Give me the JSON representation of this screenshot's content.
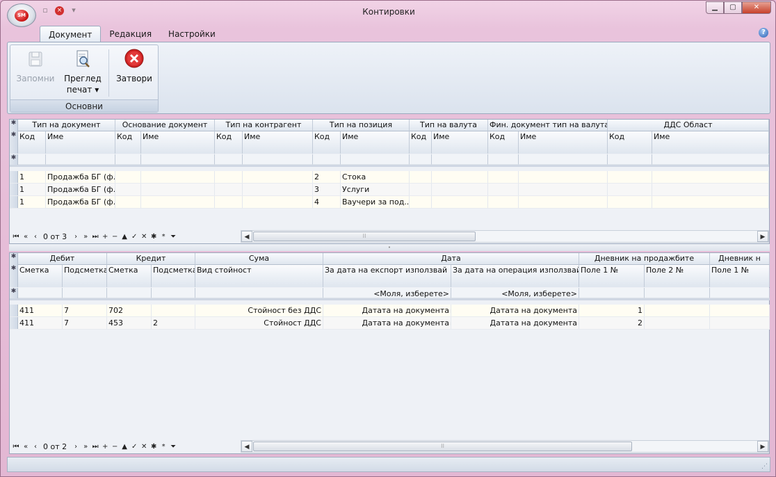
{
  "window": {
    "title": "Контировки"
  },
  "orb": {
    "logo_text": "SM"
  },
  "ribbon_tabs": [
    "Документ",
    "Редакция",
    "Настройки"
  ],
  "ribbon": {
    "group_label": "Основни",
    "save_label": "Запомни",
    "preview_label_1": "Преглед",
    "preview_label_2": "печат",
    "close_label": "Затвори"
  },
  "top_grid": {
    "groups": [
      "Тип на документ",
      "Основание документ",
      "Тип на контрагент",
      "Тип на позиция",
      "Тип на валута",
      "Фин. документ тип на валута",
      "ДДС Област"
    ],
    "columns": [
      "Код",
      "Име",
      "Код",
      "Име",
      "Код",
      "Име",
      "Код",
      "Име",
      "Код",
      "Име",
      "Код",
      "Име",
      "Код",
      "Име"
    ],
    "rows": [
      [
        "1",
        "Продажба БГ (ф...",
        "",
        "",
        "",
        "",
        "2",
        "Стока",
        "",
        "",
        "",
        "",
        "",
        ""
      ],
      [
        "1",
        "Продажба БГ (ф...",
        "",
        "",
        "",
        "",
        "3",
        "Услуги",
        "",
        "",
        "",
        "",
        "",
        ""
      ],
      [
        "1",
        "Продажба БГ (ф...",
        "",
        "",
        "",
        "",
        "4",
        "Ваучери за под...",
        "",
        "",
        "",
        "",
        "",
        ""
      ]
    ],
    "nav_text": "0 от 3"
  },
  "bottom_grid": {
    "groups": [
      "Дебит",
      "Кредит",
      "Сума",
      "Дата",
      "Дневник на продажбите",
      "Дневник н"
    ],
    "columns": [
      "Сметка",
      "Подсметка",
      "Сметка",
      "Подсметка",
      "Вид стойност",
      "За дата на експорт използвай",
      "За дата на операция използвай",
      "Поле 1 №",
      "Поле 2 №",
      "Поле 1 №"
    ],
    "filter_placeholder_1": "<Моля, изберете>",
    "filter_placeholder_2": "<Моля, изберете>",
    "rows": [
      [
        "411",
        "7",
        "702",
        "",
        "Стойност без ДДС",
        "Датата на документа",
        "Датата на документа",
        "1",
        "",
        ""
      ],
      [
        "411",
        "7",
        "453",
        "2",
        "Стойност ДДС",
        "Датата на документа",
        "Датата на документа",
        "2",
        "",
        ""
      ]
    ],
    "nav_text": "0 от 2"
  },
  "colors": {
    "accent": "#2c62b4",
    "close_red": "#c8412b",
    "window_frame": "#e9c3dc"
  },
  "icons": {
    "save": "floppy-disk-icon",
    "preview": "print-preview-icon",
    "close": "red-x-close-icon",
    "help": "help-question-icon"
  }
}
